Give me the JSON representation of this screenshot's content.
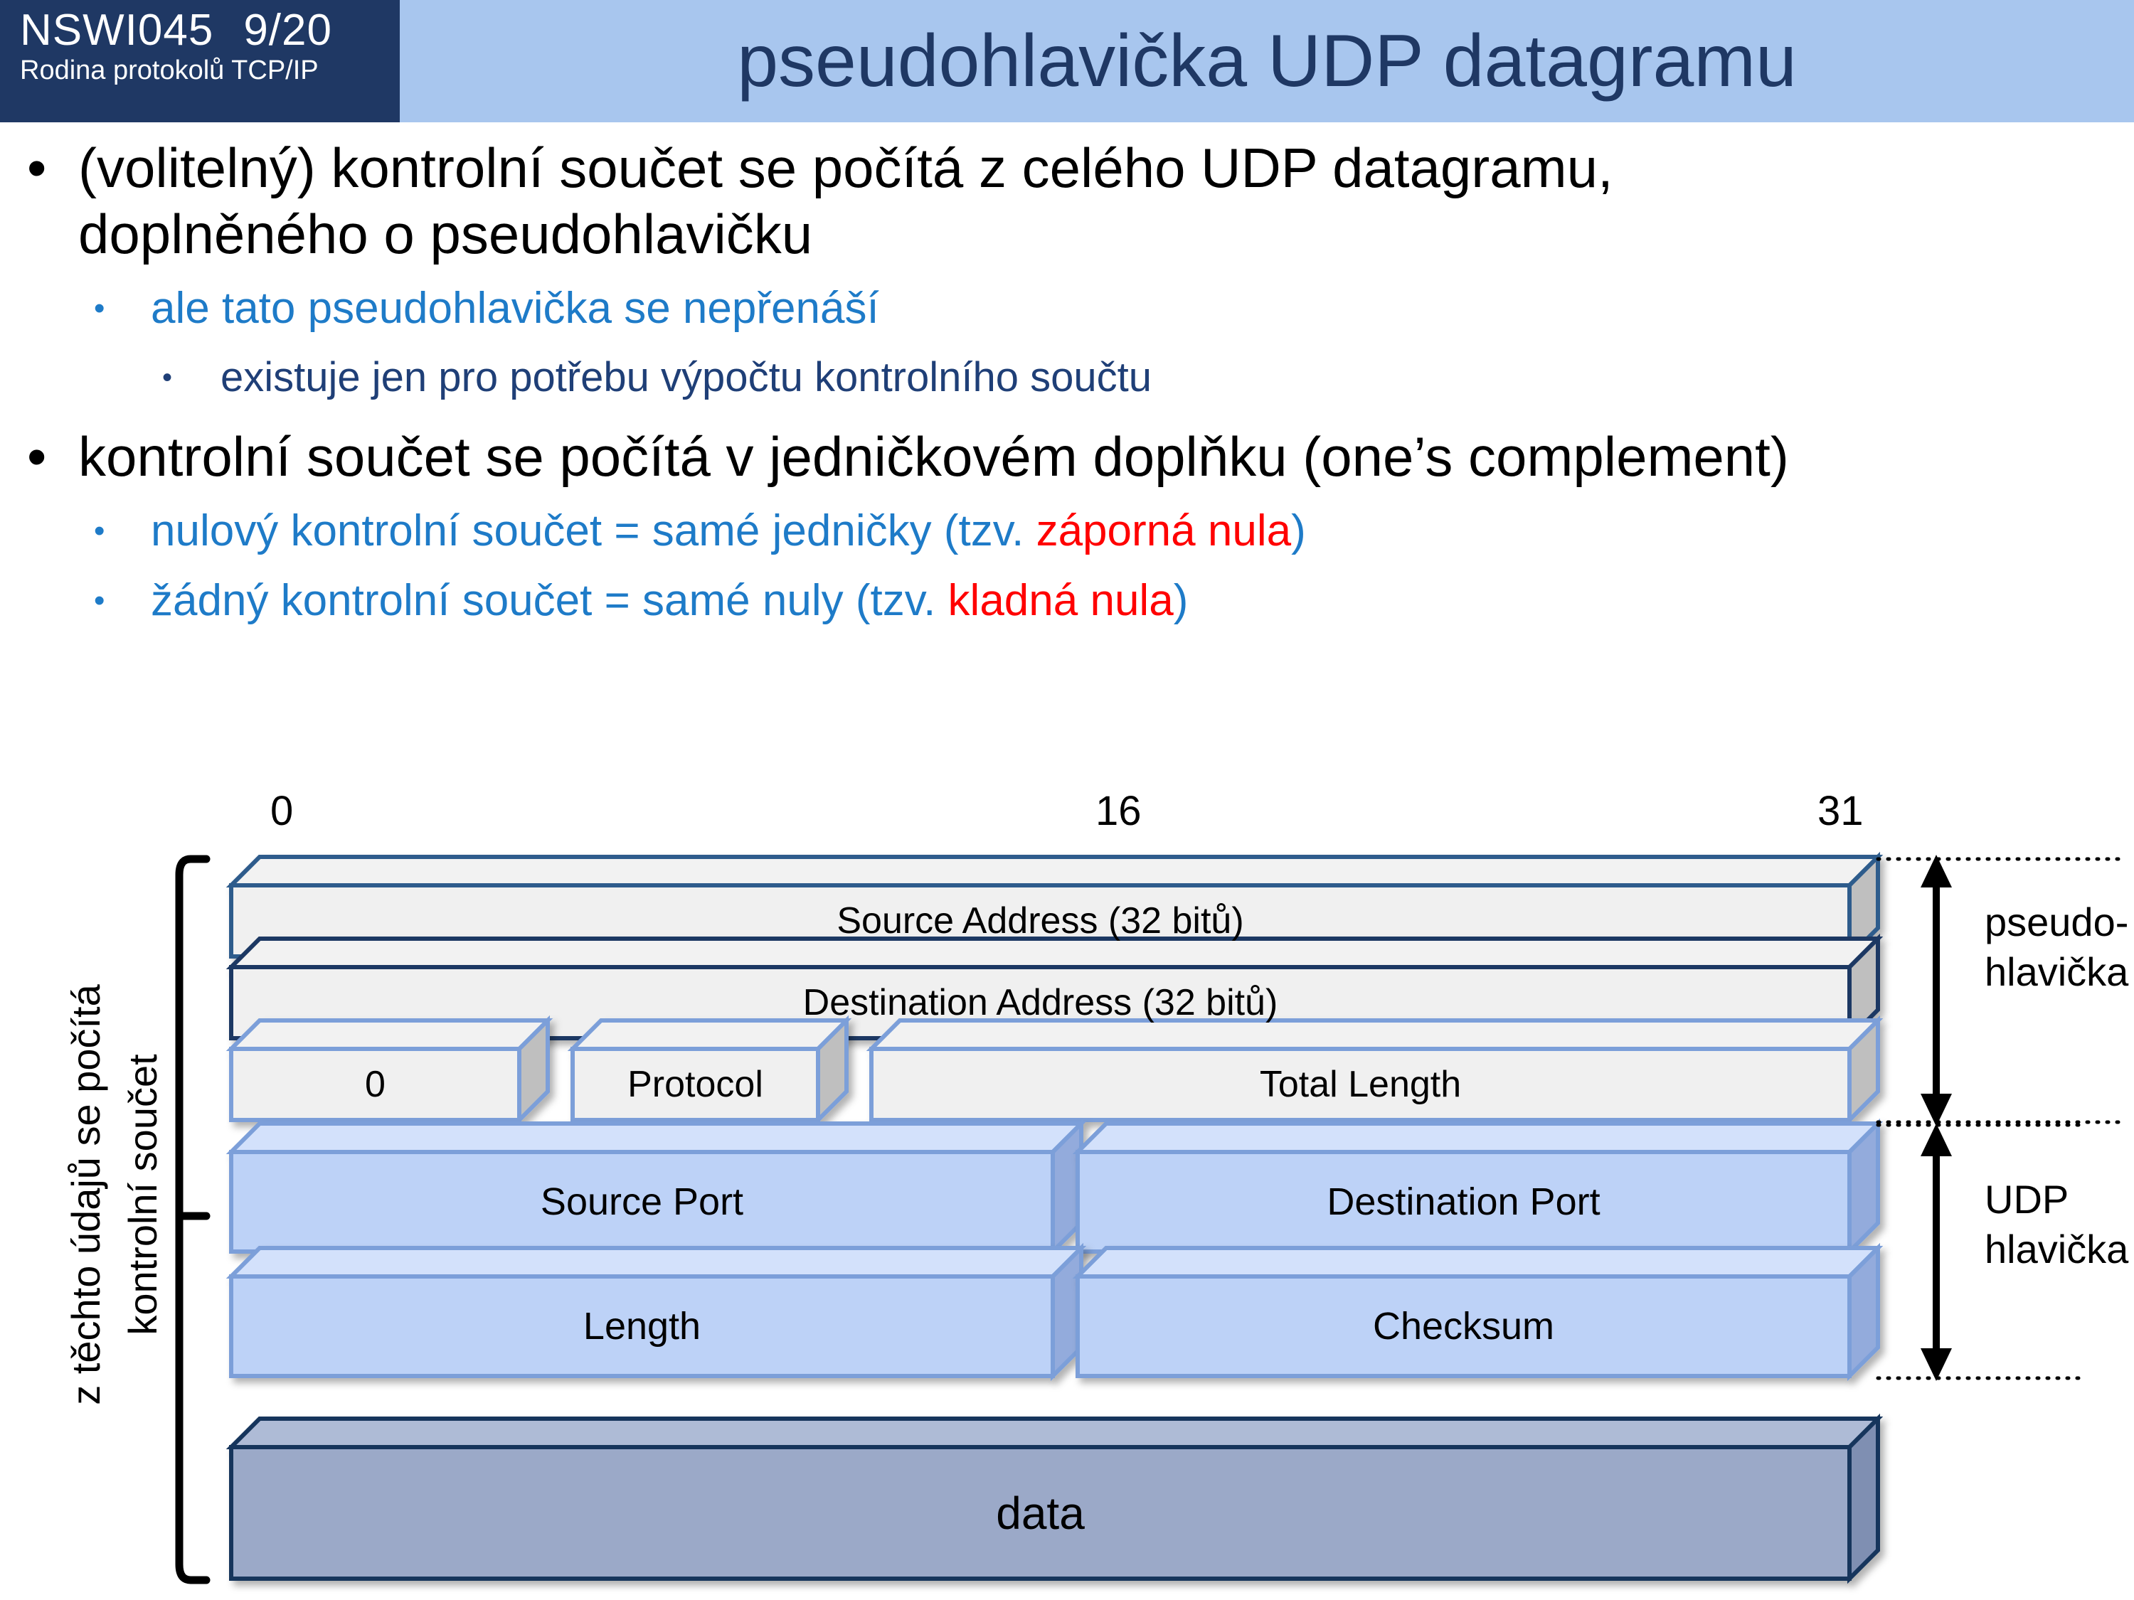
{
  "header": {
    "course_code": "NSWI045",
    "slide_number": "9/20",
    "course_subtitle": "Rodina protokolů TCP/IP",
    "title": "pseudohlavička UDP datagramu",
    "tag_bg": "#1F3864",
    "band_bg": "#A8C6EE",
    "title_color": "#1F3864"
  },
  "bullets": [
    {
      "level": 1,
      "marker": "•",
      "color": "#000000",
      "line1": "(volitelný) kontrolní součet se počítá z celého UDP datagramu,",
      "line2": "doplněného o pseudohlavičku"
    },
    {
      "level": 2,
      "marker": "•",
      "color": "#1E7BC8",
      "text": "ale tato pseudohlavička se nepřenáší"
    },
    {
      "level": 3,
      "marker": "•",
      "color": "#1F3F77",
      "text": "existuje jen pro potřebu výpočtu kontrolního součtu"
    },
    {
      "level": 1,
      "marker": "•",
      "color": "#000000",
      "text": "kontrolní součet se počítá v jedničkovém doplňku (one’s complement)"
    },
    {
      "level": 2,
      "marker": "•",
      "color": "#1E7BC8",
      "text_a": "nulový kontrolní součet = samé jedničky (tzv. ",
      "text_hi": "záporná nula",
      "text_b": ")",
      "highlight_color": "#FF0000"
    },
    {
      "level": 2,
      "marker": "•",
      "color": "#1E7BC8",
      "text_a": "žádný kontrolní součet  =  samé nuly (tzv. ",
      "text_hi": "kladná nula",
      "text_b": ")",
      "highlight_color": "#FF0000"
    }
  ],
  "diagram": {
    "bit_labels": [
      "0",
      "16",
      "31"
    ],
    "left_caption_line1": "z těchto údajů se počítá",
    "left_caption_line2": "kontrolní součet",
    "right_labels": [
      {
        "line1": "pseudo-",
        "line2": "hlavička"
      },
      {
        "line1": "UDP",
        "line2": "hlavička"
      }
    ],
    "rows": [
      {
        "group": "pseudo-header",
        "fields": [
          {
            "label": "Source Address (32 bitů)"
          }
        ]
      },
      {
        "group": "pseudo-header",
        "fields": [
          {
            "label": "Destination Address (32 bitů)"
          }
        ]
      },
      {
        "group": "pseudo-header",
        "fields": [
          {
            "label": "0"
          },
          {
            "label": "Protocol"
          },
          {
            "label": "Total Length"
          }
        ]
      },
      {
        "group": "udp-header",
        "fields": [
          {
            "label": "Source Port"
          },
          {
            "label": "Destination Port"
          }
        ]
      },
      {
        "group": "udp-header",
        "fields": [
          {
            "label": "Length"
          },
          {
            "label": "Checksum"
          }
        ]
      },
      {
        "group": "payload",
        "fields": [
          {
            "label": "data"
          }
        ]
      }
    ],
    "colors": {
      "pseudo_face": "#F0F0F0",
      "pseudo_side": "#BFBFBF",
      "pseudo_stroke_a": "#2E5B8C",
      "pseudo_stroke_b": "#1F3864",
      "pseudo_stroke_c": "#7B9FD9",
      "udp_face": "#BDD2F7",
      "udp_side": "#93ABDC",
      "udp_stroke": "#7B9FD9",
      "payload_face": "#9BA9C8",
      "payload_side": "#7F8FB2",
      "payload_stroke": "#16365C"
    }
  }
}
